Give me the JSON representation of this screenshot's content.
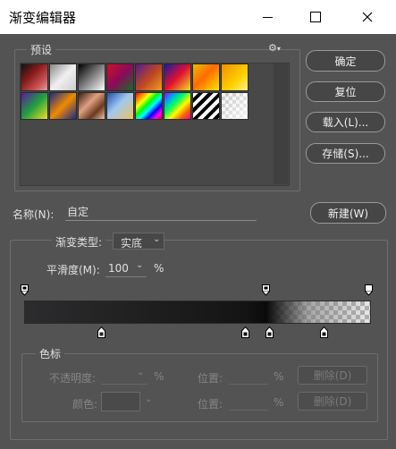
{
  "window": {
    "title": "渐变编辑器"
  },
  "presets": {
    "label": "预设"
  },
  "buttons": {
    "ok": "确定",
    "reset": "复位",
    "load": "载入(L)...",
    "save": "存储(S)...",
    "new": "新建(W)"
  },
  "name": {
    "label": "名称(N):",
    "value": "自定"
  },
  "gradient_type": {
    "label": "渐变类型:",
    "value": "实底"
  },
  "smoothness": {
    "label": "平滑度(M):",
    "value": "100",
    "unit": "%"
  },
  "stops": {
    "label": "色标",
    "opacity_label": "不透明度:",
    "opacity_unit": "%",
    "location_label": "位置:",
    "location_unit": "%",
    "delete_label": "删除(D)",
    "color_label": "颜色:"
  },
  "colors": {
    "panel": "#535353",
    "accent_border": "#9a9a9a",
    "text": "#e0e0e0"
  }
}
